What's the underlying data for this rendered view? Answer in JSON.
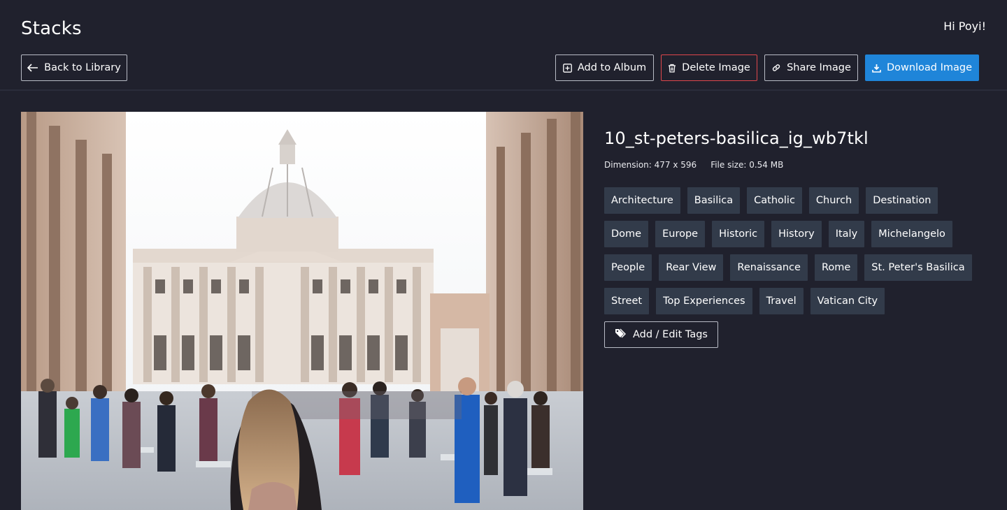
{
  "app": {
    "title": "Stacks",
    "greeting": "Hi Poyi!"
  },
  "toolbar": {
    "back_label": "Back to Library",
    "add_album_label": "Add to Album",
    "delete_label": "Delete Image",
    "share_label": "Share Image",
    "download_label": "Download Image"
  },
  "image": {
    "name": "10_st-peters-basilica_ig_wb7tkl",
    "dimension": "Dimension: 477 x 596",
    "file_size": "File size: 0.54 MB"
  },
  "tags": [
    "Architecture",
    "Basilica",
    "Catholic",
    "Church",
    "Destination",
    "Dome",
    "Europe",
    "Historic",
    "History",
    "Italy",
    "Michelangelo",
    "People",
    "Rear View",
    "Renaissance",
    "Rome",
    "St. Peter's Basilica",
    "Street",
    "Top Experiences",
    "Travel",
    "Vatican City"
  ],
  "tags_action": {
    "label": "Add / Edit Tags"
  },
  "colors": {
    "background": "#20212d",
    "tag_background": "#323b4a",
    "primary": "#1f85d9",
    "danger": "#e0474c"
  },
  "icons": {
    "back": "arrow-left-icon",
    "album": "plus-square-icon",
    "delete": "trash-icon",
    "share": "link-icon",
    "download": "download-icon",
    "tags": "tags-icon"
  }
}
